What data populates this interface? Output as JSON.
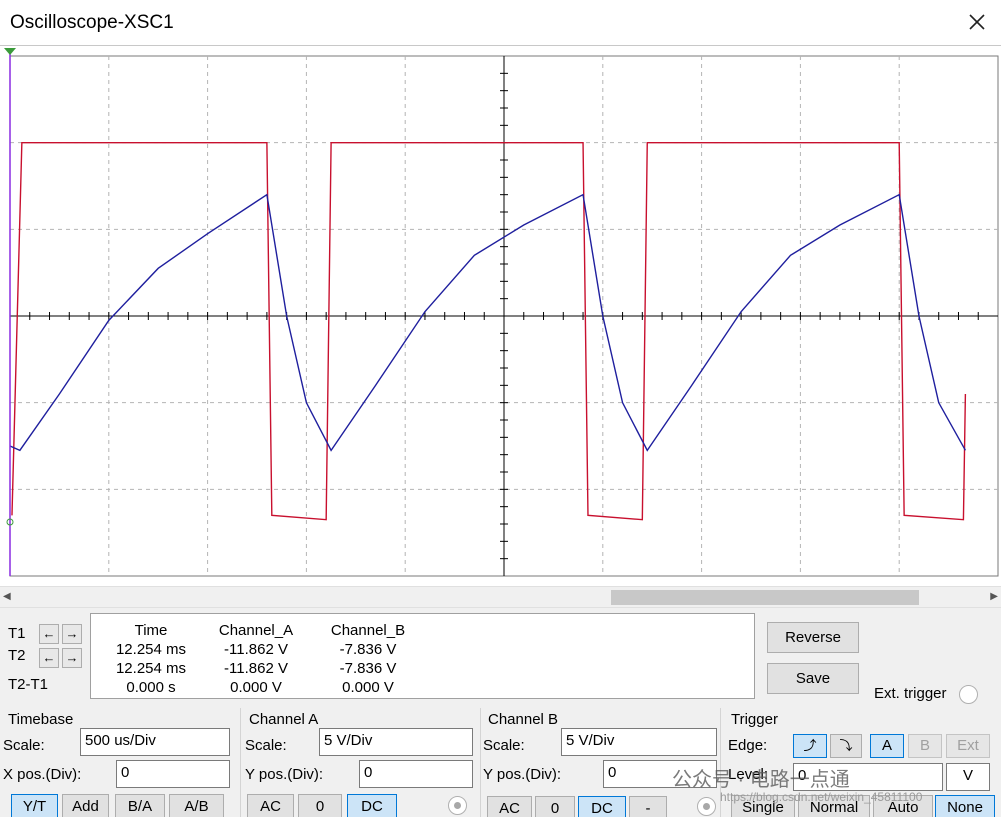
{
  "window": {
    "title": "Oscilloscope-XSC1"
  },
  "colors": {
    "channel_a": "#c8102e",
    "channel_b": "#1f1f9e",
    "grid": "#b4b4b4",
    "cursor": "#8a2be2"
  },
  "chart_data": {
    "type": "line",
    "title": "",
    "xlabel": "",
    "ylabel": "",
    "x_divisions": 10,
    "y_divisions": 6,
    "grid": true,
    "y_units": "divisions",
    "series": [
      {
        "name": "Channel_A",
        "points": [
          [
            0.02,
            -2.3
          ],
          [
            0.12,
            2.0
          ],
          [
            2.6,
            2.0
          ],
          [
            2.65,
            -2.3
          ],
          [
            3.2,
            -2.35
          ],
          [
            3.25,
            2.0
          ],
          [
            5.8,
            2.0
          ],
          [
            5.85,
            -2.3
          ],
          [
            6.4,
            -2.35
          ],
          [
            6.45,
            2.0
          ],
          [
            9.0,
            2.0
          ],
          [
            9.05,
            -2.3
          ],
          [
            9.65,
            -2.35
          ],
          [
            9.67,
            -0.9
          ]
        ]
      },
      {
        "name": "Channel_B",
        "points": [
          [
            0.0,
            -1.5
          ],
          [
            0.1,
            -1.55
          ],
          [
            0.5,
            -0.9
          ],
          [
            1.0,
            -0.05
          ],
          [
            1.5,
            0.55
          ],
          [
            2.0,
            0.95
          ],
          [
            2.6,
            1.4
          ],
          [
            2.8,
            0.0
          ],
          [
            3.0,
            -1.0
          ],
          [
            3.25,
            -1.55
          ],
          [
            3.7,
            -0.8
          ],
          [
            4.2,
            0.05
          ],
          [
            4.7,
            0.7
          ],
          [
            5.2,
            1.05
          ],
          [
            5.8,
            1.4
          ],
          [
            6.0,
            0.0
          ],
          [
            6.2,
            -1.0
          ],
          [
            6.45,
            -1.55
          ],
          [
            6.9,
            -0.8
          ],
          [
            7.4,
            0.05
          ],
          [
            7.9,
            0.7
          ],
          [
            8.4,
            1.05
          ],
          [
            9.0,
            1.4
          ],
          [
            9.2,
            0.0
          ],
          [
            9.4,
            -1.0
          ],
          [
            9.67,
            -1.55
          ]
        ]
      }
    ]
  },
  "cursors": {
    "t1_label": "T1",
    "t2_label": "T2",
    "diff_label": "T2-T1",
    "t1_left": "←",
    "t1_right": "→",
    "t2_left": "←",
    "t2_right": "→"
  },
  "readout": {
    "headers": [
      "Time",
      "Channel_A",
      "Channel_B"
    ],
    "rows": [
      [
        "12.254 ms",
        "-11.862 V",
        "-7.836 V"
      ],
      [
        "12.254 ms",
        "-11.862 V",
        "-7.836 V"
      ],
      [
        "0.000 s",
        "0.000 V",
        "0.000 V"
      ]
    ]
  },
  "actions": {
    "reverse": "Reverse",
    "save": "Save",
    "ext_trigger": "Ext. trigger"
  },
  "timebase": {
    "title": "Timebase",
    "scale_label": "Scale:",
    "scale_value": "500 us/Div",
    "xpos_label": "X pos.(Div):",
    "xpos_value": "0",
    "modes": [
      "Y/T",
      "Add",
      "B/A",
      "A/B"
    ]
  },
  "channel_a": {
    "title": "Channel A",
    "scale_label": "Scale:",
    "scale_value": "5  V/Div",
    "ypos_label": "Y pos.(Div):",
    "ypos_value": "0",
    "coupling": [
      "AC",
      "0",
      "DC"
    ]
  },
  "channel_b": {
    "title": "Channel B",
    "scale_label": "Scale:",
    "scale_value": "5  V/Div",
    "ypos_label": "Y pos.(Div):",
    "ypos_value": "0",
    "coupling": [
      "AC",
      "0",
      "DC",
      "-"
    ]
  },
  "trigger": {
    "title": "Trigger",
    "edge_label": "Edge:",
    "rise_glyph": "⤴",
    "fall_glyph": "⤵",
    "sources": [
      "A",
      "B",
      "Ext"
    ],
    "level_label": "Level:",
    "level_value": "0",
    "level_unit": "V",
    "modes": [
      "Single",
      "Normal",
      "Auto",
      "None"
    ]
  },
  "watermark": {
    "text": "公众号 · 电路一点通",
    "url": "https://blog.csdn.net/weixin_45811100"
  }
}
